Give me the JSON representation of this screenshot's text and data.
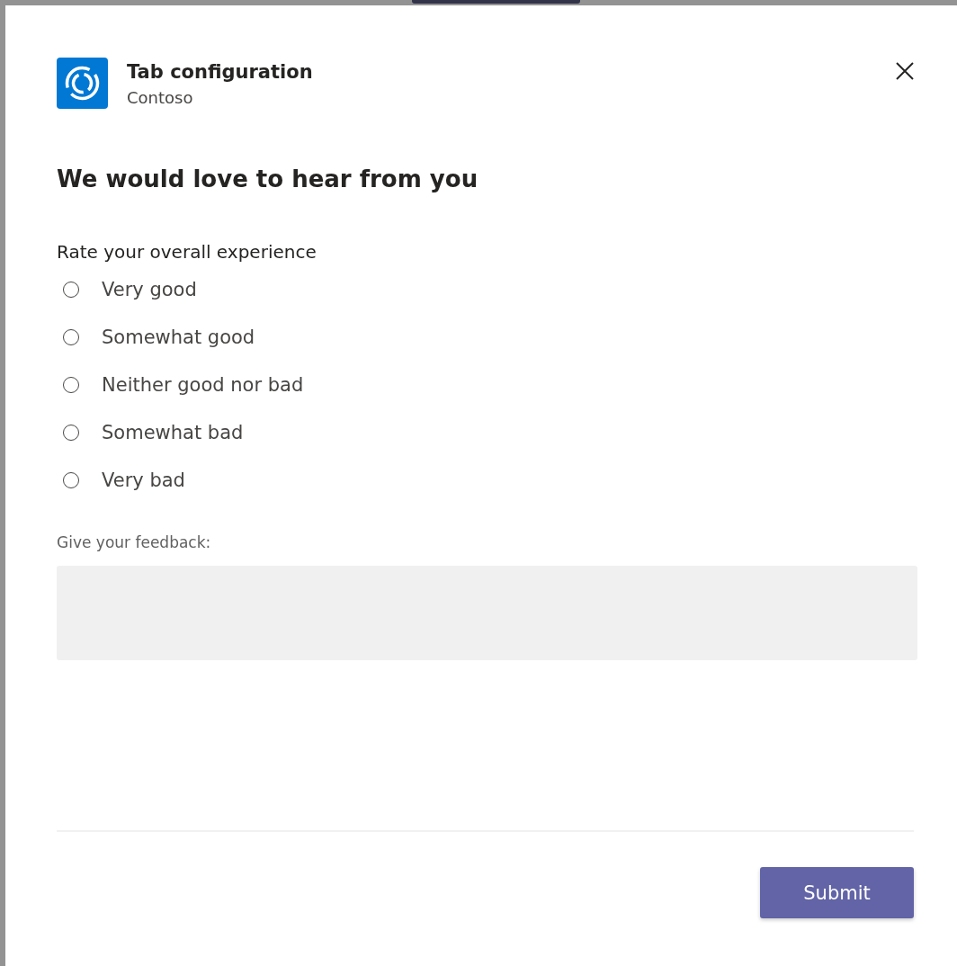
{
  "dialog": {
    "title": "Tab configuration",
    "subtitle": "Contoso"
  },
  "heading": "We would love to hear from you",
  "rating": {
    "label": "Rate your overall experience",
    "options": [
      {
        "label": "Very good",
        "selected": false
      },
      {
        "label": "Somewhat good",
        "selected": false
      },
      {
        "label": "Neither good nor bad",
        "selected": false
      },
      {
        "label": "Somewhat bad",
        "selected": false
      },
      {
        "label": "Very bad",
        "selected": false
      }
    ]
  },
  "feedback": {
    "label": "Give your feedback:"
  },
  "buttons": [
    "Submit"
  ]
}
